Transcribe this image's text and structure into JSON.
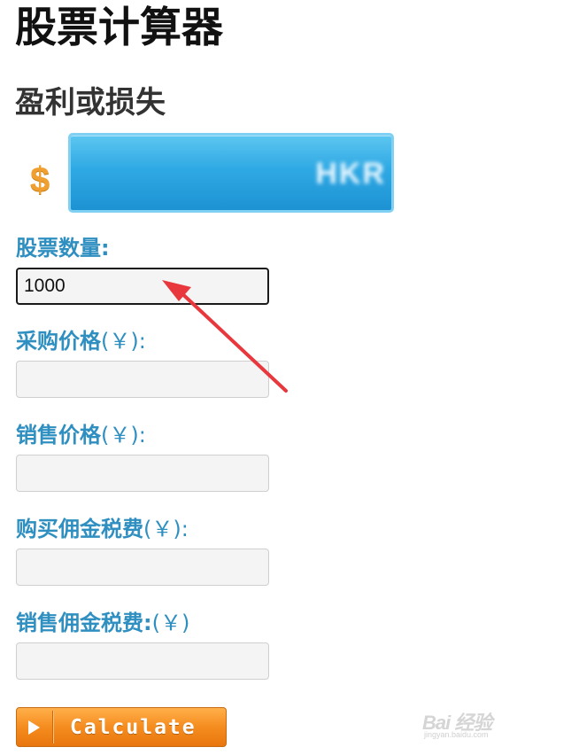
{
  "page": {
    "title": "股票计算器"
  },
  "section": {
    "title": "盈利或损失"
  },
  "result": {
    "currency_symbol": "$",
    "value": "HKR"
  },
  "fields": [
    {
      "label": "股票数量:",
      "unit": "",
      "value": "1000",
      "placeholder": ""
    },
    {
      "label": "采购价格",
      "unit": "(￥):",
      "value": "",
      "placeholder": ""
    },
    {
      "label": "销售价格",
      "unit": "(￥):",
      "value": "",
      "placeholder": ""
    },
    {
      "label": "购买佣金税费",
      "unit": "(￥):",
      "value": "",
      "placeholder": ""
    },
    {
      "label": "销售佣金税费:",
      "unit": "(￥)",
      "value": "",
      "placeholder": ""
    }
  ],
  "calculate_button": {
    "label": "Calculate",
    "icon": "play-icon"
  },
  "annotation": {
    "color": "#e8383d"
  },
  "watermark": {
    "main": "Bai 经验",
    "sub": "jingyan.baidu.com"
  }
}
